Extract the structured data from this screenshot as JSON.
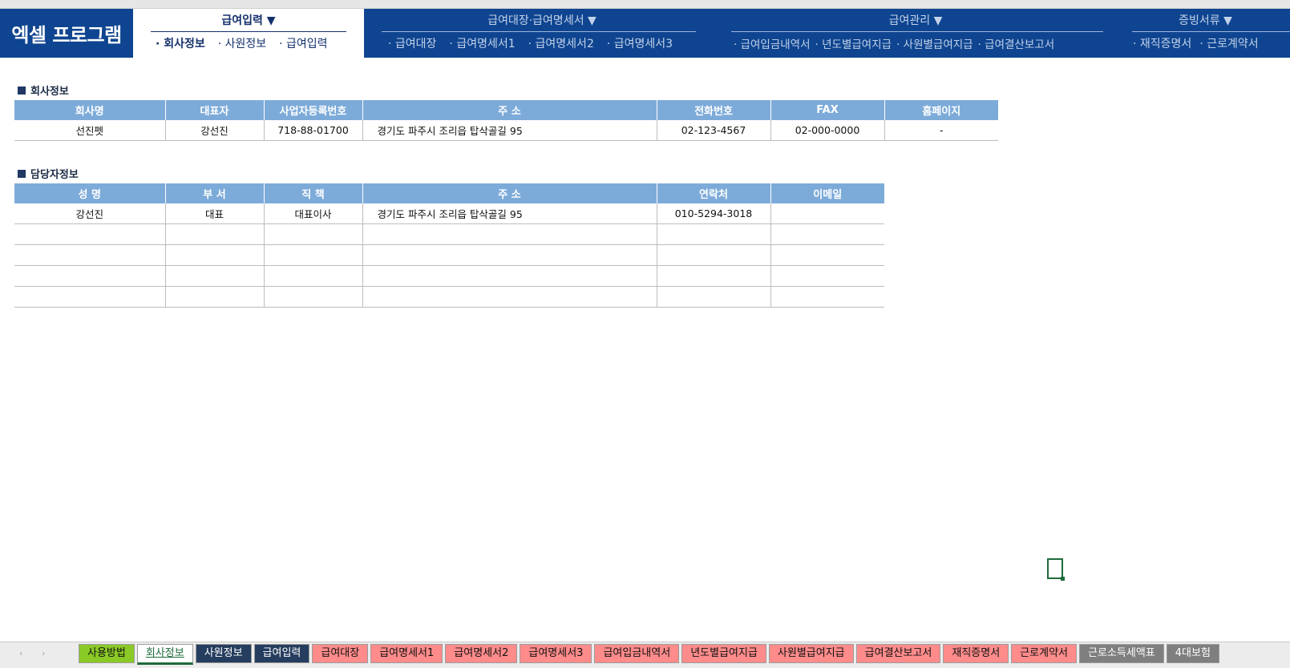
{
  "header": {
    "logo": "엑셀 프로그램",
    "groups": [
      {
        "title": "급여입력 ▼",
        "items": [
          "· 회사정보",
          "· 사원정보",
          "· 급여입력"
        ]
      },
      {
        "title": "급여대장·급여명세서 ▼",
        "items": [
          "· 급여대장",
          "· 급여명세서1",
          "· 급여명세서2",
          "· 급여명세서3"
        ]
      },
      {
        "title": "급여관리 ▼",
        "items": [
          "· 급여입금내역서",
          "· 년도별급여지급",
          "· 사원별급여지급",
          "· 급여결산보고서"
        ]
      },
      {
        "title": "증빙서류 ▼",
        "items": [
          "· 재직증명서",
          "· 근로계약서"
        ]
      }
    ]
  },
  "company": {
    "section_title": "회사정보",
    "headers": [
      "회사명",
      "대표자",
      "사업자등록번호",
      "주 소",
      "전화번호",
      "FAX",
      "홈페이지"
    ],
    "row": [
      "선진펫",
      "강선진",
      "718-88-01700",
      "경기도 파주시 조리읍 탑삭골길 95",
      "02-123-4567",
      "02-000-0000",
      "-"
    ]
  },
  "contact": {
    "section_title": "담당자정보",
    "headers": [
      "성 명",
      "부 서",
      "직 책",
      "주 소",
      "연락처",
      "이메일"
    ],
    "rows": [
      [
        "강선진",
        "대표",
        "대표이사",
        "경기도 파주시 조리읍 탑삭골길 95",
        "010-5294-3018",
        ""
      ],
      [
        "",
        "",
        "",
        "",
        "",
        ""
      ],
      [
        "",
        "",
        "",
        "",
        "",
        ""
      ],
      [
        "",
        "",
        "",
        "",
        "",
        ""
      ],
      [
        "",
        "",
        "",
        "",
        "",
        ""
      ]
    ]
  },
  "sheet_tabs": {
    "left_arrow": "‹",
    "right_arrow": "›",
    "tabs": [
      {
        "label": "사용방법",
        "color": "green"
      },
      {
        "label": "회사정보",
        "color": "active"
      },
      {
        "label": "사원정보",
        "color": "navy"
      },
      {
        "label": "급여입력",
        "color": "navy"
      },
      {
        "label": "급여대장",
        "color": "pink"
      },
      {
        "label": "급여명세서1",
        "color": "pink"
      },
      {
        "label": "급여명세서2",
        "color": "pink"
      },
      {
        "label": "급여명세서3",
        "color": "pink"
      },
      {
        "label": "급여입금내역서",
        "color": "pink"
      },
      {
        "label": "년도별급여지급",
        "color": "pink"
      },
      {
        "label": "사원별급여지급",
        "color": "pink"
      },
      {
        "label": "급여결산보고서",
        "color": "pink"
      },
      {
        "label": "재직증명서",
        "color": "pink"
      },
      {
        "label": "근로계약서",
        "color": "pink"
      },
      {
        "label": "근로소득세액표",
        "color": "gray"
      },
      {
        "label": "4대보험",
        "color": "gray"
      }
    ]
  },
  "colors": {
    "header_bg": "#0f4590",
    "table_header": "#7dabd9",
    "active_tab": "#1e6b3a"
  }
}
